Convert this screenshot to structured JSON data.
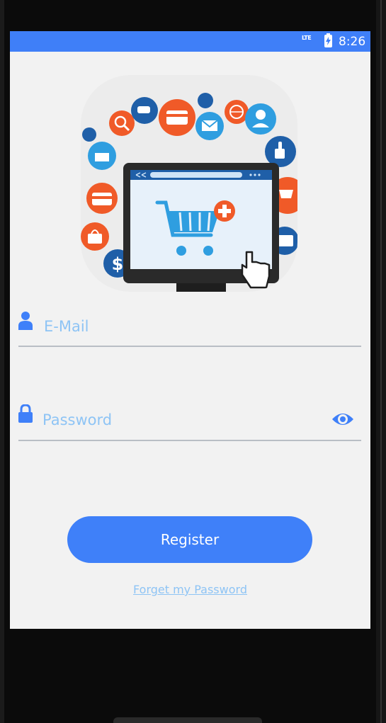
{
  "status_bar": {
    "network": "LTE",
    "time": "8:26",
    "background_color": "#3f7ff8"
  },
  "hero": {
    "icons": [
      "shopping-cart-icon",
      "plus-icon",
      "hand-cursor-icon",
      "credit-card-icon",
      "search-icon",
      "mail-icon",
      "globe-icon",
      "user-icon",
      "thumbs-up-icon",
      "basket-icon",
      "bag-icon",
      "dollar-icon"
    ]
  },
  "form": {
    "email": {
      "placeholder": "E-Mail",
      "icon": "person-icon"
    },
    "password": {
      "placeholder": "Password",
      "icon": "lock-icon",
      "toggle_icon": "eye-icon"
    }
  },
  "actions": {
    "register_label": "Register",
    "forgot_label": "Forget my Password"
  },
  "colors": {
    "accent": "#3f80f9",
    "placeholder": "#8ec4f5",
    "screen_background": "#f2f2f2"
  }
}
